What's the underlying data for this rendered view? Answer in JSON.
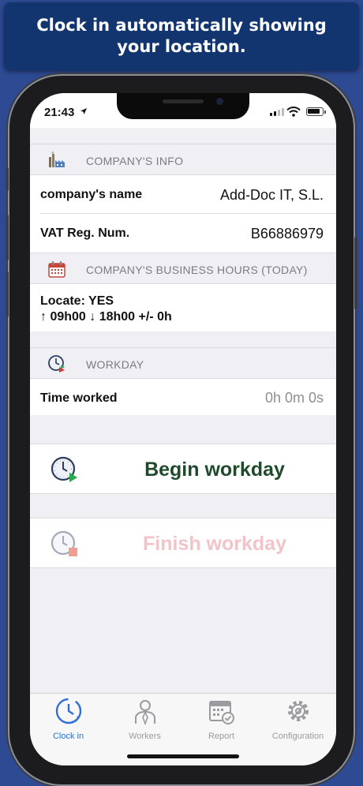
{
  "banner": {
    "text": "Clock in automatically showing your location."
  },
  "status_bar": {
    "time": "21:43"
  },
  "sections": {
    "company_info": {
      "header": "COMPANY'S INFO",
      "rows": [
        {
          "label": "company's name",
          "value": "Add-Doc IT, S.L."
        },
        {
          "label": "VAT Reg. Num.",
          "value": "B66886979"
        }
      ]
    },
    "business_hours": {
      "header": "COMPANY'S BUSINESS HOURS (TODAY)",
      "locate": "Locate: YES",
      "hours": "↑ 09h00 ↓ 18h00 +/- 0h"
    },
    "workday": {
      "header": "WORKDAY",
      "time_worked_label": "Time worked",
      "time_worked_value": "0h 0m 0s"
    }
  },
  "actions": {
    "begin": {
      "label": "Begin workday",
      "color": "#1f4a2c"
    },
    "finish": {
      "label": "Finish workday",
      "color": "#f0c4c8"
    }
  },
  "tabbar": {
    "items": [
      {
        "label": "Clock in",
        "icon": "clock-icon",
        "active": true
      },
      {
        "label": "Workers",
        "icon": "worker-icon",
        "active": false
      },
      {
        "label": "Report",
        "icon": "calendar-check-icon",
        "active": false
      },
      {
        "label": "Configuration",
        "icon": "gear-icon",
        "active": false
      }
    ],
    "active_color": "#2f6fd6",
    "inactive_color": "#9a9aa0"
  }
}
